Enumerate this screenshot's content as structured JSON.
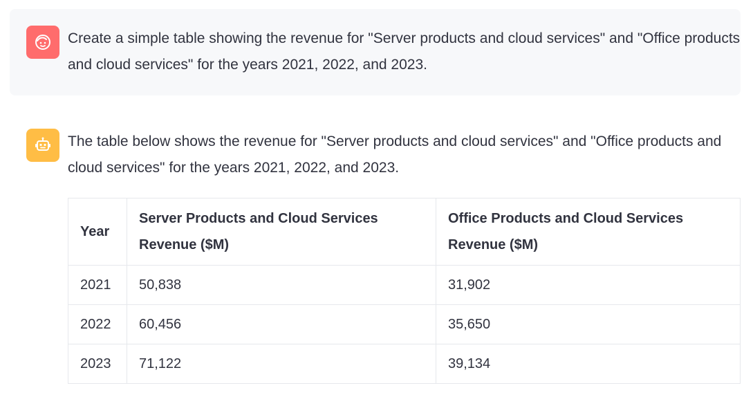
{
  "conversation": {
    "user_message": {
      "avatar_icon": "user-face-icon",
      "avatar_color": "#ff6c6c",
      "text": "Create a simple table showing the revenue for \"Server products and cloud services\" and \"Office products and cloud services\" for the years 2021, 2022, and 2023."
    },
    "assistant_message": {
      "avatar_icon": "robot-icon",
      "avatar_color": "#ffbd45",
      "text": "The table below shows the revenue for \"Server products and cloud services\" and \"Office products and cloud services\" for the years 2021, 2022, and 2023.",
      "table": {
        "headers": [
          "Year",
          "Server Products and Cloud Services Revenue ($M)",
          "Office Products and Cloud Services Revenue ($M)"
        ],
        "rows": [
          [
            "2021",
            "50,838",
            "31,902"
          ],
          [
            "2022",
            "60,456",
            "35,650"
          ],
          [
            "2023",
            "71,122",
            "39,134"
          ]
        ]
      }
    }
  }
}
